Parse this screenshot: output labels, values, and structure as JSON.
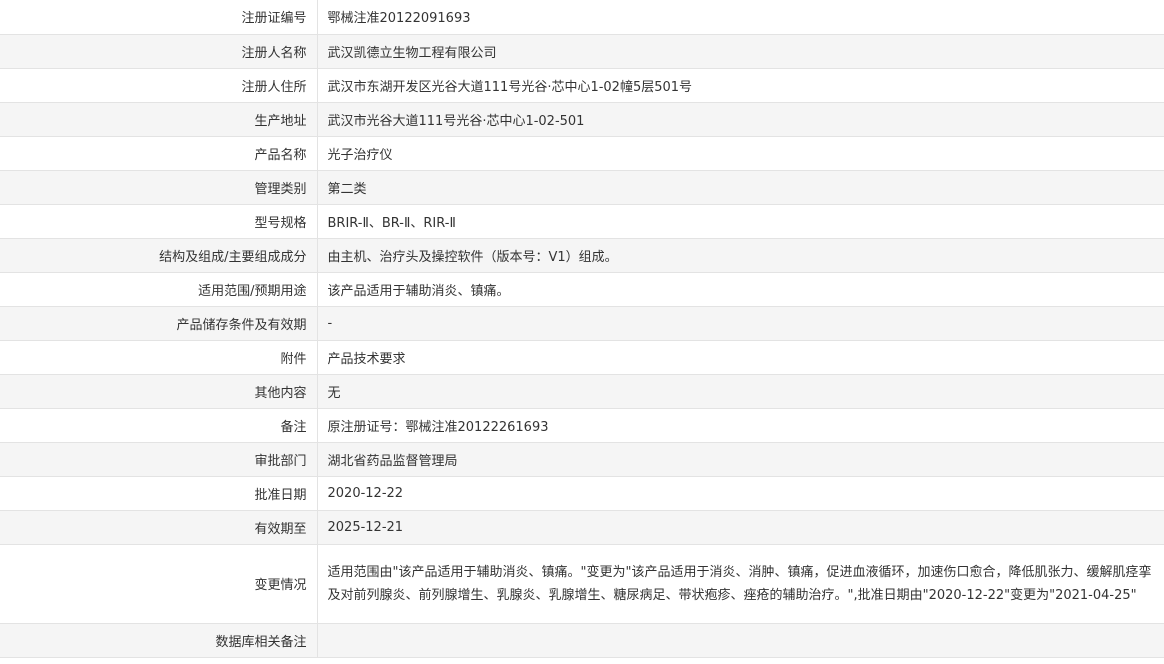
{
  "rows": [
    {
      "label": "注册证编号",
      "value": "鄂械注准20122091693"
    },
    {
      "label": "注册人名称",
      "value": "武汉凯德立生物工程有限公司"
    },
    {
      "label": "注册人住所",
      "value": "武汉市东湖开发区光谷大道111号光谷·芯中心1-02幢5层501号"
    },
    {
      "label": "生产地址",
      "value": "武汉市光谷大道111号光谷·芯中心1-02-501"
    },
    {
      "label": "产品名称",
      "value": "光子治疗仪"
    },
    {
      "label": "管理类别",
      "value": "第二类"
    },
    {
      "label": "型号规格",
      "value": "BRIR-Ⅱ、BR-Ⅱ、RIR-Ⅱ"
    },
    {
      "label": "结构及组成/主要组成成分",
      "value": "由主机、治疗头及操控软件（版本号：V1）组成。"
    },
    {
      "label": "适用范围/预期用途",
      "value": "该产品适用于辅助消炎、镇痛。"
    },
    {
      "label": "产品储存条件及有效期",
      "value": "-"
    },
    {
      "label": "附件",
      "value": "产品技术要求"
    },
    {
      "label": "其他内容",
      "value": "无"
    },
    {
      "label": "备注",
      "value": "原注册证号：鄂械注准20122261693"
    },
    {
      "label": "审批部门",
      "value": "湖北省药品监督管理局"
    },
    {
      "label": "批准日期",
      "value": "2020-12-22"
    },
    {
      "label": "有效期至",
      "value": "2025-12-21"
    },
    {
      "label": "变更情况",
      "value": "适用范围由\"该产品适用于辅助消炎、镇痛。\"变更为\"该产品适用于消炎、消肿、镇痛，促进血液循环，加速伤口愈合，降低肌张力、缓解肌痉挛及对前列腺炎、前列腺增生、乳腺炎、乳腺增生、糖尿病足、带状疱疹、痤疮的辅助治疗。\",批准日期由\"2020-12-22\"变更为\"2021-04-25\""
    },
    {
      "label": "数据库相关备注",
      "value": ""
    }
  ]
}
